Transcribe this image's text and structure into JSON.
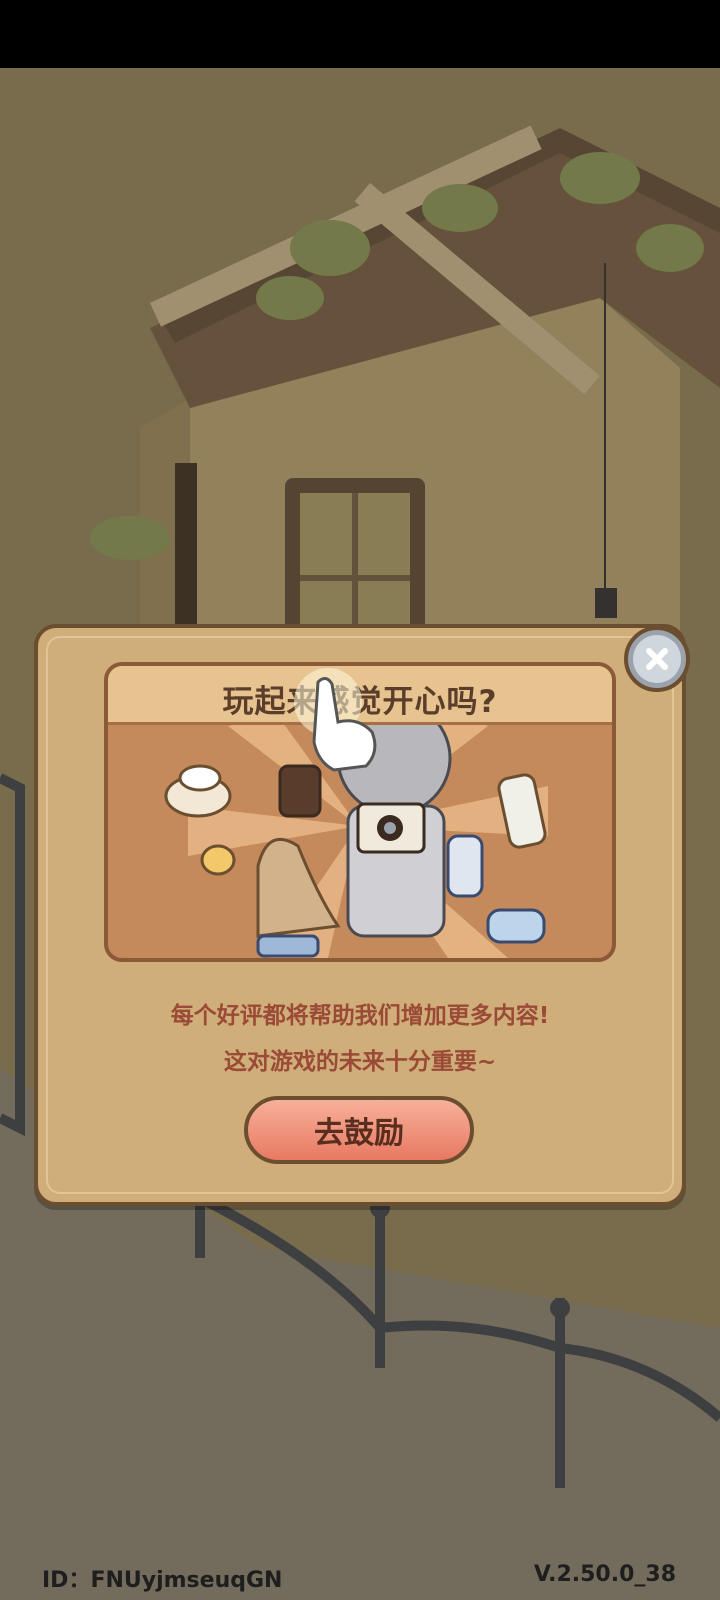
{
  "dialog": {
    "title": "玩起来感觉开心吗?",
    "message_line1": "每个好评都将帮助我们增加更多内容!",
    "message_line2": "这对游戏的未来十分重要~",
    "action_button_label": "去鼓励",
    "close_icon": "close-icon"
  },
  "footer": {
    "player_id": "ID：FNUyjmseuqGN",
    "version": "V.2.50.0_38"
  },
  "icons": {
    "pointer": "tap-hand-icon"
  },
  "colors": {
    "dialog_bg": "#cfae7a",
    "button_bg": "#e87962",
    "text_accent": "#9a4a36"
  }
}
